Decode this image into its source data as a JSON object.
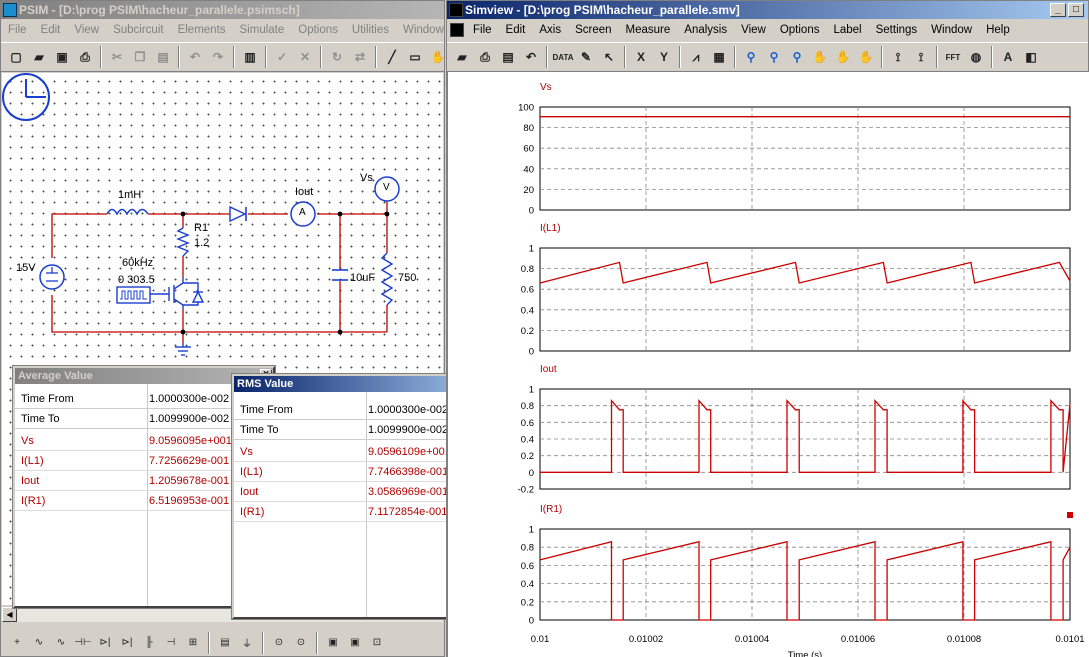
{
  "psim": {
    "title": "PSIM - [D:\\prog PSIM\\hacheur_parallele.psimsch]",
    "menu": [
      "File",
      "Edit",
      "View",
      "Subcircuit",
      "Elements",
      "Simulate",
      "Options",
      "Utilities",
      "Window",
      "Hel"
    ],
    "toolbar_icons": [
      "new-file-icon",
      "open-folder-icon",
      "save-icon",
      "print-icon",
      "cut-icon",
      "copy-icon",
      "paste-icon",
      "undo-icon",
      "redo-icon",
      "clipboard-icon",
      "check-icon",
      "cross-icon",
      "rotate-icon",
      "flip-icon",
      "wire-icon",
      "label-icon",
      "hand-icon"
    ],
    "bottom_icons": [
      "ground-element-icon",
      "resistor-element-icon",
      "inductor-element-icon",
      "capacitor-element-icon",
      "diode-element-icon",
      "thyristor-element-icon",
      "igbt-element-icon",
      "switch-element-icon",
      "source-element-icon",
      "meter-element-icon",
      "probe-element-icon",
      "voltage-probe-icon",
      "current-probe-icon",
      "scope-icon",
      "scope2-icon",
      "more-icon"
    ],
    "circuit": {
      "source_value": "15V",
      "inductor_value": "1mH",
      "resistor1_name": "R1",
      "resistor1_value": "1.2",
      "freq_label": "60kHz",
      "duty_label": "0  303.5",
      "ammeter_name": "Iout",
      "ammeter_symbol": "A",
      "voltmeter_name": "Vs",
      "voltmeter_symbol": "V",
      "capacitor_value": "10uF",
      "load_value": "750"
    }
  },
  "average_window": {
    "title": "Average Value",
    "time_from_label": "Time   From",
    "time_from_value": "1.0000300e-002",
    "time_to_label": "Time   To",
    "time_to_value": "1.0099900e-002",
    "rows": [
      {
        "name": "Vs",
        "value": "9.0596095e+001"
      },
      {
        "name": "I(L1)",
        "value": "7.7256629e-001"
      },
      {
        "name": "Iout",
        "value": "1.2059678e-001"
      },
      {
        "name": "I(R1)",
        "value": "6.5196953e-001"
      }
    ]
  },
  "rms_window": {
    "title": "RMS Value",
    "time_from_label": "Time   From",
    "time_from_value": "1.0000300e-002",
    "time_to_label": "Time   To",
    "time_to_value": "1.0099900e-002",
    "rows": [
      {
        "name": "Vs",
        "value": "9.0596109e+001"
      },
      {
        "name": "I(L1)",
        "value": "7.7466398e-001"
      },
      {
        "name": "Iout",
        "value": "3.0586969e-001"
      },
      {
        "name": "I(R1)",
        "value": "7.1172854e-001"
      }
    ]
  },
  "simview": {
    "title": "Simview - [D:\\prog PSIM\\hacheur_parallele.smv]",
    "menu": [
      "File",
      "Edit",
      "Axis",
      "Screen",
      "Measure",
      "Analysis",
      "View",
      "Options",
      "Label",
      "Settings",
      "Window",
      "Help"
    ],
    "toolbar": [
      {
        "icon": "open-folder-icon",
        "glyph": "▰"
      },
      {
        "icon": "print-icon",
        "glyph": "⎙"
      },
      {
        "icon": "copy-icon",
        "glyph": "▤"
      },
      {
        "icon": "undo-icon",
        "glyph": "↶"
      },
      {
        "icon": "data-icon",
        "glyph": "DATA"
      },
      {
        "icon": "edit-data-icon",
        "glyph": "✎"
      },
      {
        "icon": "select-icon",
        "glyph": "↖"
      },
      {
        "icon": "x-axis-icon",
        "glyph": "X"
      },
      {
        "icon": "y-axis-icon",
        "glyph": "Y"
      },
      {
        "icon": "chart-icon",
        "glyph": "⩘"
      },
      {
        "icon": "screen-icon",
        "glyph": "▦"
      },
      {
        "icon": "zoom-icon",
        "glyph": "⚲"
      },
      {
        "icon": "zoom-in-icon",
        "glyph": "⚲"
      },
      {
        "icon": "zoom-out-icon",
        "glyph": "⚲"
      },
      {
        "icon": "pan-hand-icon",
        "glyph": "✋"
      },
      {
        "icon": "pan-hand-left-icon",
        "glyph": "✋"
      },
      {
        "icon": "pan-hand-right-icon",
        "glyph": "✋"
      },
      {
        "icon": "measure-icon",
        "glyph": "⟟"
      },
      {
        "icon": "measure-text-icon",
        "glyph": "⟟"
      },
      {
        "icon": "fft-icon",
        "glyph": "FFT"
      },
      {
        "icon": "globe-icon",
        "glyph": "◍"
      },
      {
        "icon": "text-label-icon",
        "glyph": "A"
      },
      {
        "icon": "color-icon",
        "glyph": "◧"
      }
    ]
  },
  "chart_data": {
    "type": "line",
    "xlabel": "Time (s)",
    "xlim": [
      0.01,
      0.0101
    ],
    "xticks": [
      "0.01",
      "0.01002",
      "0.01004",
      "0.01006",
      "0.01008",
      "0.0101"
    ],
    "trace_color": "#cc0000",
    "grid": true,
    "series": [
      {
        "name": "Vs",
        "ylim": [
          0,
          100
        ],
        "yticks": [
          "100",
          "80",
          "60",
          "40",
          "20",
          "0"
        ],
        "x": [
          0.01,
          0.0101
        ],
        "y": [
          90.6,
          90.6
        ]
      },
      {
        "name": "I(L1)",
        "ylim": [
          0,
          1
        ],
        "yticks": [
          "1",
          "0.8",
          "0.6",
          "0.4",
          "0.2",
          "0"
        ],
        "x": [
          0.01,
          0.010015,
          0.0100157,
          0.0100315,
          0.0100322,
          0.0100482,
          0.0100489,
          0.0100648,
          0.0100655,
          0.0100813,
          0.010082,
          0.010098,
          0.0101
        ],
        "y": [
          0.66,
          0.86,
          0.66,
          0.86,
          0.66,
          0.86,
          0.66,
          0.86,
          0.66,
          0.86,
          0.66,
          0.86,
          0.68
        ]
      },
      {
        "name": "Iout",
        "ylim": [
          -0.2,
          1
        ],
        "yticks": [
          "1",
          "0.8",
          "0.6",
          "0.4",
          "0.2",
          "0",
          "-0.2"
        ],
        "x": [
          0.01,
          0.0100135,
          0.0100135,
          0.010015,
          0.0100157,
          0.0100157,
          0.01003,
          0.01003,
          0.0100315,
          0.0100322,
          0.0100322,
          0.0100466,
          0.0100466,
          0.0100482,
          0.0100489,
          0.0100489,
          0.0100632,
          0.0100632,
          0.0100648,
          0.0100655,
          0.0100655,
          0.0100798,
          0.0100798,
          0.0100813,
          0.010082,
          0.010082,
          0.0100964,
          0.0100964,
          0.010098,
          0.0100987,
          0.0100987,
          0.0101
        ],
        "y": [
          0,
          0,
          0.86,
          0.75,
          0.75,
          0,
          0,
          0.86,
          0.75,
          0.75,
          0,
          0,
          0.86,
          0.75,
          0.75,
          0,
          0,
          0.86,
          0.75,
          0.75,
          0,
          0,
          0.86,
          0.75,
          0.75,
          0,
          0,
          0.86,
          0.75,
          0.75,
          0,
          0.82
        ]
      },
      {
        "name": "I(R1)",
        "ylim": [
          0,
          1
        ],
        "yticks": [
          "1",
          "0.8",
          "0.6",
          "0.4",
          "0.2",
          "0"
        ],
        "x": [
          0.01,
          0.0100135,
          0.0100135,
          0.010015,
          0.0100157,
          0.0100157,
          0.01003,
          0.01003,
          0.0100315,
          0.0100322,
          0.0100322,
          0.0100466,
          0.0100466,
          0.0100482,
          0.0100489,
          0.0100489,
          0.0100632,
          0.0100632,
          0.0100648,
          0.0100655,
          0.0100655,
          0.0100798,
          0.0100798,
          0.0100813,
          0.010082,
          0.010082,
          0.0100964,
          0.0100964,
          0.010098,
          0.0100987,
          0.0100987,
          0.0101
        ],
        "y": [
          0.66,
          0.86,
          0,
          0,
          0,
          0.66,
          0.86,
          0,
          0,
          0,
          0.66,
          0.86,
          0,
          0,
          0,
          0.66,
          0.86,
          0,
          0,
          0,
          0.66,
          0.86,
          0,
          0,
          0,
          0.66,
          0.86,
          0,
          0,
          0,
          0.66,
          0.8
        ]
      }
    ]
  }
}
